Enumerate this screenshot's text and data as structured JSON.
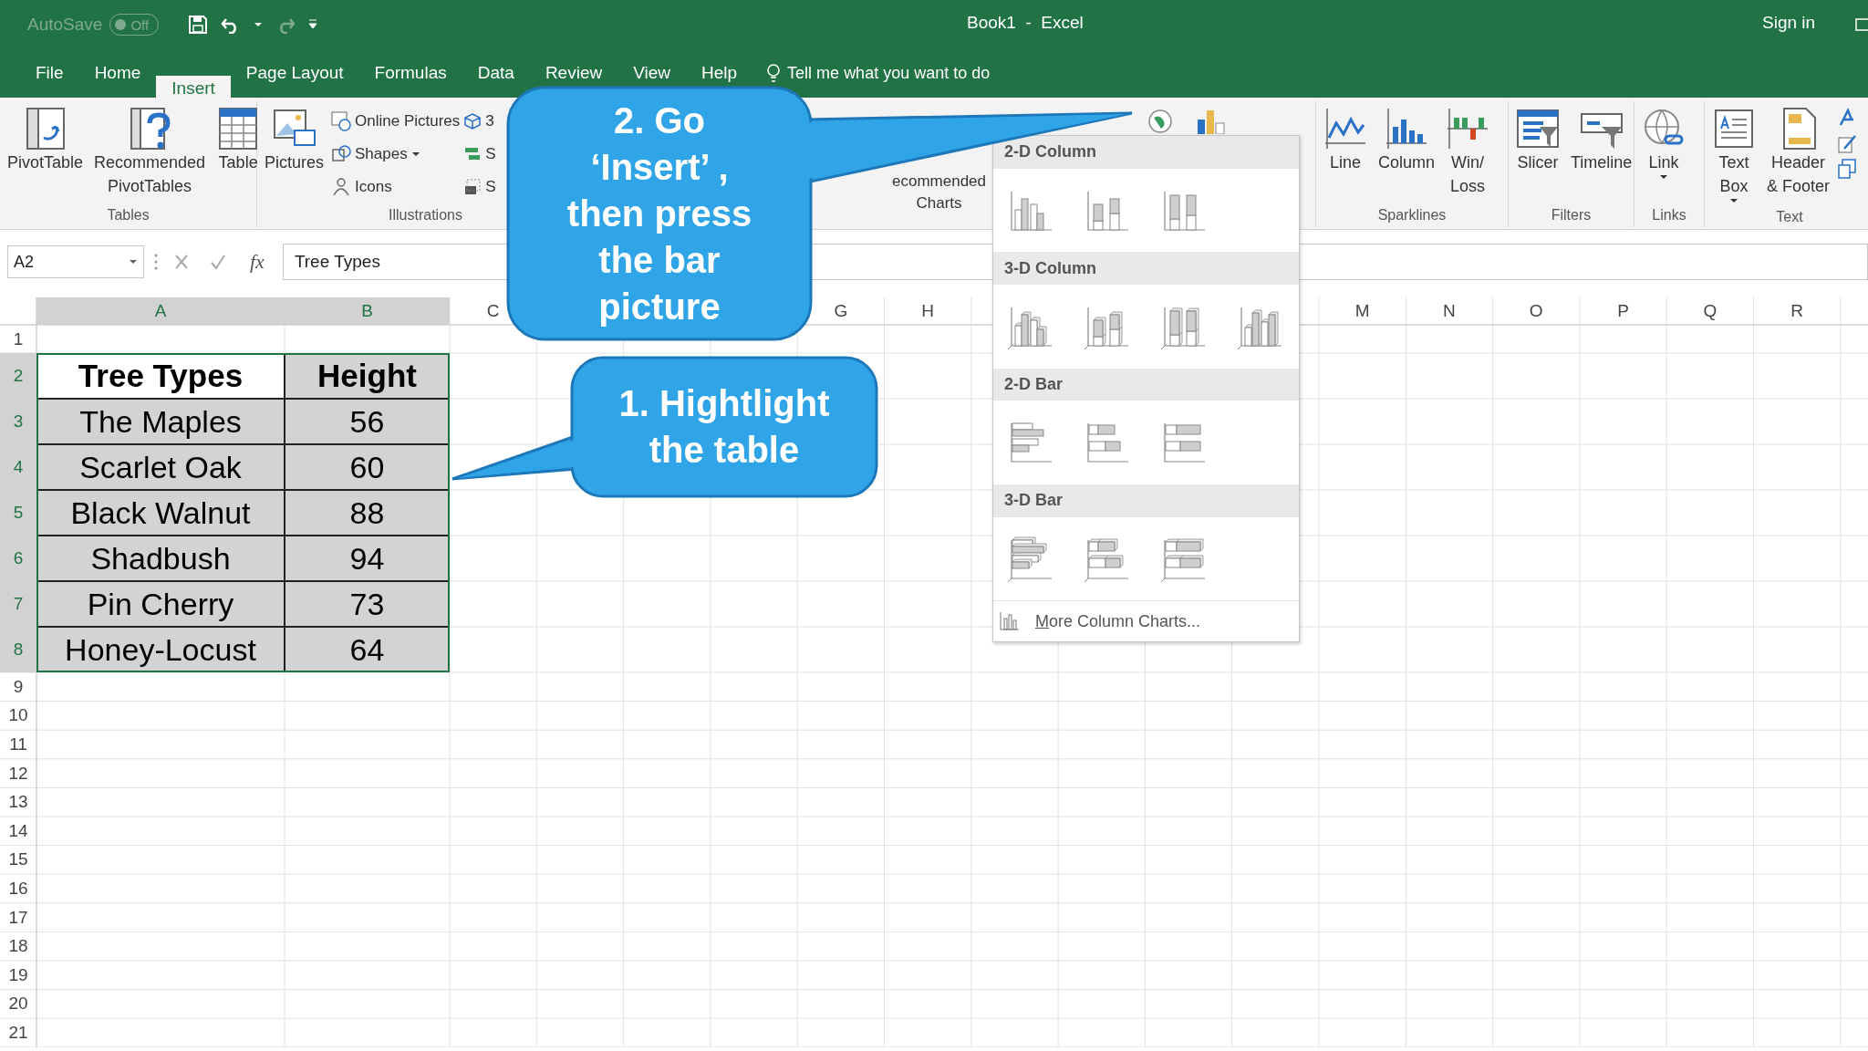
{
  "title_bar": {
    "autosave": {
      "label": "AutoSave",
      "on": false,
      "state": "Off"
    },
    "title": "Book1  -  Excel",
    "sign_in": "Sign in"
  },
  "tabs": [
    {
      "label": "File",
      "selected": false
    },
    {
      "label": "Home",
      "selected": false
    },
    {
      "label": "Insert",
      "selected": true
    },
    {
      "label": "Page Layout",
      "selected": false
    },
    {
      "label": "Formulas",
      "selected": false
    },
    {
      "label": "Data",
      "selected": false
    },
    {
      "label": "Review",
      "selected": false
    },
    {
      "label": "View",
      "selected": false
    },
    {
      "label": "Help",
      "selected": false
    }
  ],
  "tell_me": {
    "placeholder": "Tell me what you want to do"
  },
  "ribbon": {
    "tables": {
      "label": "Tables",
      "buttons": [
        "PivotTable",
        "Recommended\nPivotTables",
        "Table"
      ]
    },
    "illustrations": {
      "label": "Illustrations",
      "pictures": "Pictures",
      "small": [
        "Online Pictures",
        "Shapes",
        "Icons"
      ],
      "cut": [
        "3",
        "S",
        "S"
      ]
    },
    "charts": {
      "button": "ecommended\nCharts"
    },
    "sparklines": {
      "label": "Sparklines",
      "buttons": [
        "Line",
        "Column",
        "Win/\nLoss"
      ]
    },
    "filters": {
      "label": "Filters",
      "buttons": [
        "Slicer",
        "Timeline"
      ]
    },
    "links": {
      "label": "Links",
      "buttons": [
        "Link"
      ]
    },
    "text": {
      "label": "Text",
      "buttons": [
        "Text\nBox",
        "Header\n& Footer"
      ]
    }
  },
  "formula_bar": {
    "name_box": "A2",
    "fx": "fx",
    "formula": "Tree Types"
  },
  "sheet": {
    "column_headers": [
      "A",
      "B",
      "C",
      "G",
      "H",
      "M",
      "N",
      "O",
      "P",
      "Q",
      "R"
    ],
    "row_numbers": [
      "1",
      "2",
      "3",
      "4",
      "5",
      "6",
      "7",
      "8",
      "9",
      "10",
      "11",
      "12",
      "13",
      "14",
      "15",
      "16",
      "17",
      "18",
      "19",
      "20",
      "21"
    ],
    "table": {
      "selected": true,
      "header": [
        "Tree Types",
        "Height"
      ],
      "rows": [
        [
          "The Maples",
          "56"
        ],
        [
          "Scarlet Oak",
          "60"
        ],
        [
          "Black Walnut",
          "88"
        ],
        [
          "Shadbush",
          "94"
        ],
        [
          "Pin Cherry",
          "73"
        ],
        [
          "Honey-Locust",
          "64"
        ]
      ]
    }
  },
  "chart_menu": {
    "sections": [
      {
        "title": "2-D Column",
        "items": [
          {
            "kind": "clustered-column"
          },
          {
            "kind": "stacked-column"
          },
          {
            "kind": "percent-column"
          }
        ]
      },
      {
        "title": "3-D Column",
        "items": [
          {
            "kind": "clustered-column-3d"
          },
          {
            "kind": "stacked-column-3d"
          },
          {
            "kind": "percent-column-3d"
          },
          {
            "kind": "column-3d"
          }
        ]
      },
      {
        "title": "2-D Bar",
        "items": [
          {
            "kind": "clustered-bar"
          },
          {
            "kind": "stacked-bar"
          },
          {
            "kind": "percent-bar"
          }
        ]
      },
      {
        "title": "3-D Bar",
        "items": [
          {
            "kind": "clustered-bar-3d"
          },
          {
            "kind": "stacked-bar-3d"
          },
          {
            "kind": "percent-bar-3d"
          }
        ]
      }
    ],
    "footer": "More Column Charts..."
  },
  "callouts": [
    {
      "text": "2. Go\n‘Insert’ ,\nthen press\nthe bar\npicture"
    },
    {
      "text": "1. Hightlight\nthe table"
    }
  ]
}
